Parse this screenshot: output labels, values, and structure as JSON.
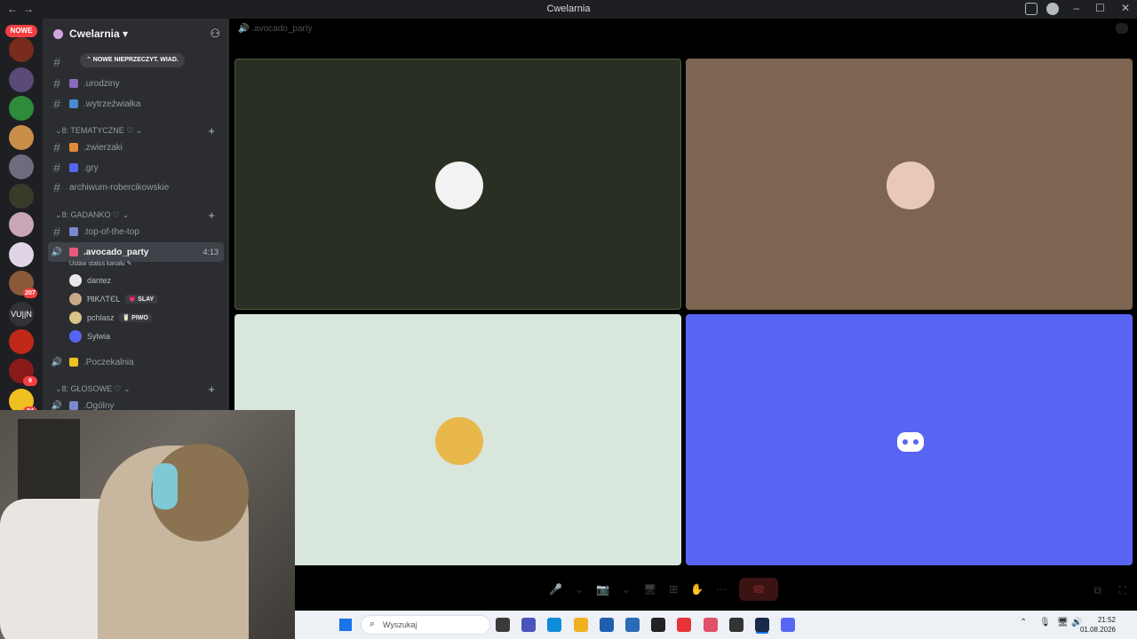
{
  "window": {
    "title": "Cwelarnia",
    "nav_back": "←",
    "nav_fwd": "→"
  },
  "rail": {
    "new_badge": "NOWE",
    "servers": [
      {
        "color": "#7a2c1c"
      },
      {
        "color": "#5a4a7a",
        "badge": ""
      },
      {
        "color": "#2e8b3a"
      },
      {
        "color": "#c98e4a"
      },
      {
        "color": "#6e6a80"
      },
      {
        "color": "#3a3a2a"
      },
      {
        "color": "#c9a5b8"
      },
      {
        "color": "#e0d5e5"
      },
      {
        "color": "#8a5a3a",
        "badge": "207"
      },
      {
        "text": "VU||N"
      },
      {
        "color": "#c0281a"
      },
      {
        "color": "#8a1a1a",
        "badge": "9"
      },
      {
        "color": "#f0c020",
        "badge": "84"
      }
    ]
  },
  "server": {
    "name": "Cwelarnia ▾"
  },
  "banner": "⌃ NOWE NIEPRZECZYT. WIAD.",
  "channels": [
    {
      "label": ".urodziny",
      "emoji_color": "#8a6abf"
    },
    {
      "label": ".wytrzeźwiałka",
      "emoji_color": "#4a8acf"
    }
  ],
  "categories": {
    "tematyczne": "⌄8: TEMATYCZNE ♡ ⌄",
    "gadanko": "⌄8: GADANKO ♡ ⌄",
    "glosowe": "⌄8: GŁOSOWE ♡ ⌄"
  },
  "tematyczne_channels": [
    {
      "label": ".zwierzaki",
      "emoji_color": "#e08a3a"
    },
    {
      "label": ".gry",
      "emoji_color": "#5865f2"
    },
    {
      "label": "archiwum-robercikowskie"
    }
  ],
  "gadanko_channels": [
    {
      "label": ".top-of-the-top",
      "emoji_color": "#7a8acf"
    }
  ],
  "voice": {
    "active": {
      "label": ".avocado_party",
      "time": "4:13",
      "status_link": "Ustaw status kanału ✎"
    },
    "users": [
      {
        "name": "dantez",
        "tag": "",
        "color": "#e8e8e8"
      },
      {
        "name": "ĦƖƘΛƬЄL",
        "tag": "💗 SLAY",
        "color": "#c9a88a"
      },
      {
        "name": "pchlasz",
        "tag": "🥛 PIWO",
        "color": "#d9c48a"
      },
      {
        "name": "Sylwia",
        "tag": "",
        "color": "#5865f2"
      }
    ],
    "poczekalnia": ".Poczekalnia",
    "ogolny": ".Ogólny"
  },
  "call": {
    "title": ".avocado_party",
    "tiles": [
      {
        "bg": "#2a2f24",
        "avatar": "#f2f2f2",
        "border": "#4c5e3c"
      },
      {
        "bg": "#7d6552",
        "avatar": "#e8c9b8",
        "border": "#7d6552"
      },
      {
        "bg": "#d9e6dc",
        "avatar": "#e8b84a",
        "border": "#d9e6dc"
      },
      {
        "bg": "#5865f2",
        "avatar": "#5865f2",
        "border": "#5865f2"
      }
    ],
    "controls": [
      "🎤",
      "⌄",
      "📷",
      "⌄",
      "🖥",
      "⊞",
      "✋",
      "⋯"
    ],
    "hangup": "☎"
  },
  "taskbar": {
    "search_placeholder": "Wyszukaj",
    "apps": [
      "#3a3a3a",
      "#4b53bc",
      "#0f8cd7",
      "#f0b020",
      "#1f5fb0",
      "#2a6ab8",
      "#222222",
      "#e8323a",
      "#e0506a",
      "#333333",
      "#1a2b4a",
      "#5865f2"
    ],
    "tray": [
      "⌃",
      "🎙",
      "🖥",
      "🔊"
    ],
    "time": "21:52",
    "date": "01.08.2026"
  }
}
